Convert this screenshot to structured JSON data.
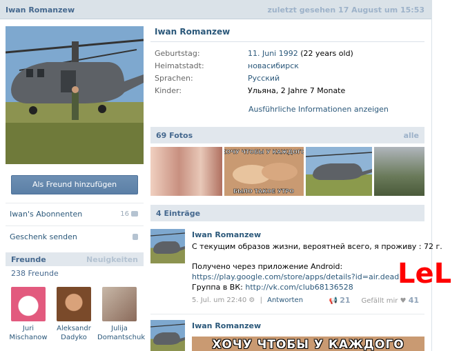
{
  "header": {
    "name": "Iwan Romanzew",
    "last_seen": "zuletzt gesehen 17 August um 15:53"
  },
  "profile": {
    "name": "Iwan Romanzew",
    "info": [
      {
        "label": "Geburtstag:",
        "value": "11. Juni 1992",
        "value_extra": " (22 years old)",
        "link": true
      },
      {
        "label": "Heimatstadt:",
        "value": "новасибирск",
        "value_extra": "",
        "link": true
      },
      {
        "label": "Sprachen:",
        "value": "Русский",
        "value_extra": "",
        "link": true
      },
      {
        "label": "Kinder:",
        "value": "Ульяна, 2 Jahre 7 Monate",
        "value_extra": "",
        "link": false
      }
    ],
    "more_info": "Ausführliche Informationen anzeigen"
  },
  "sidebar": {
    "friend_button": "Als Freund hinzufügen",
    "subscribers_label": "Iwan's Abonnenten",
    "subscribers_count": "16",
    "gift_label": "Geschenk senden",
    "friends_title": "Freunde",
    "friends_news": "Neuigkeiten",
    "friends_count": "238 Freunde",
    "friends": [
      {
        "first": "Juri",
        "last": "Mischanow"
      },
      {
        "first": "Aleksandr",
        "last": "Dadyko"
      },
      {
        "first": "Julija",
        "last": "Domantschuk"
      }
    ]
  },
  "photos": {
    "title": "69 Fotos",
    "all": "alle",
    "meme_top": "ХОЧУ ЧТОБЫ У КАЖДОГО",
    "meme_bottom": "БЫЛО ТАКОЕ УТРО"
  },
  "wall": {
    "title": "4 Einträge",
    "posts": [
      {
        "author": "Iwan Romanzew",
        "line1": "С текущим образов жизни, вероятней всего, я проживу : 72 г.",
        "line2": "Получено через приложение Android:",
        "line3": "https://play.google.com/store/apps/details?id=air.dead",
        "line4_prefix": "Группа в ВК: ",
        "line4_link": "http://vk.com/club68136528",
        "date": "5. Jul. um 22:40",
        "reply": "Antworten",
        "reposts": "21",
        "likes_label": "Gefällt mir",
        "likes": "41"
      },
      {
        "author": "Iwan Romanzew",
        "meme_text": "ХОЧУ ЧТОБЫ У КАЖДОГО"
      }
    ]
  },
  "annotation": {
    "text": "LeL",
    "color": "#ff0000"
  },
  "colors": {
    "accent": "#2b587a",
    "header_bg": "#dae2e8",
    "section_bg": "#e1e7ed",
    "button": "#5b7fa6"
  }
}
